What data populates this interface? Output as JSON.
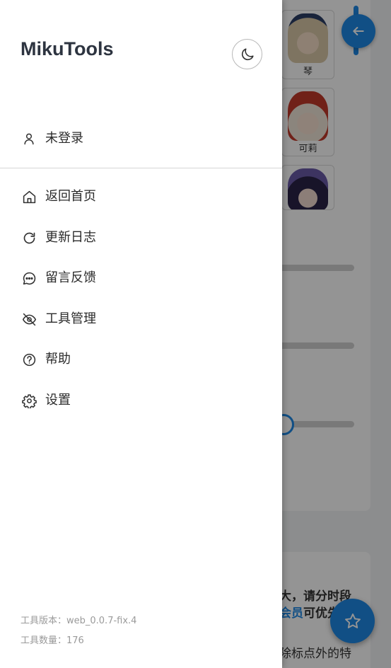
{
  "app": {
    "title": "MikuTools"
  },
  "drawer": {
    "login_label": "未登录",
    "nav": [
      {
        "label": "返回首页",
        "icon": "home-icon"
      },
      {
        "label": "更新日志",
        "icon": "refresh-icon"
      },
      {
        "label": "留言反馈",
        "icon": "chat-bubble-icon"
      },
      {
        "label": "工具管理",
        "icon": "eye-off-icon"
      },
      {
        "label": "帮助",
        "icon": "help-circle-icon"
      },
      {
        "label": "设置",
        "icon": "gear-icon"
      }
    ],
    "footer": {
      "version": "工具版本：web_0.0.7-fix.4",
      "count": "工具数量：176"
    }
  },
  "background": {
    "characters": [
      {
        "name": "琴"
      },
      {
        "name": "可莉"
      },
      {
        "name": ""
      }
    ],
    "notice_line1": "大，请分时段",
    "notice_vip": "会员",
    "notice_line2_suffix": "可优先",
    "notice_line3": "除标点外的特"
  },
  "colors": {
    "accent": "#1e88e5",
    "title": "#2d3440",
    "text": "#2b2b2b",
    "muted": "#9a9a9a"
  }
}
